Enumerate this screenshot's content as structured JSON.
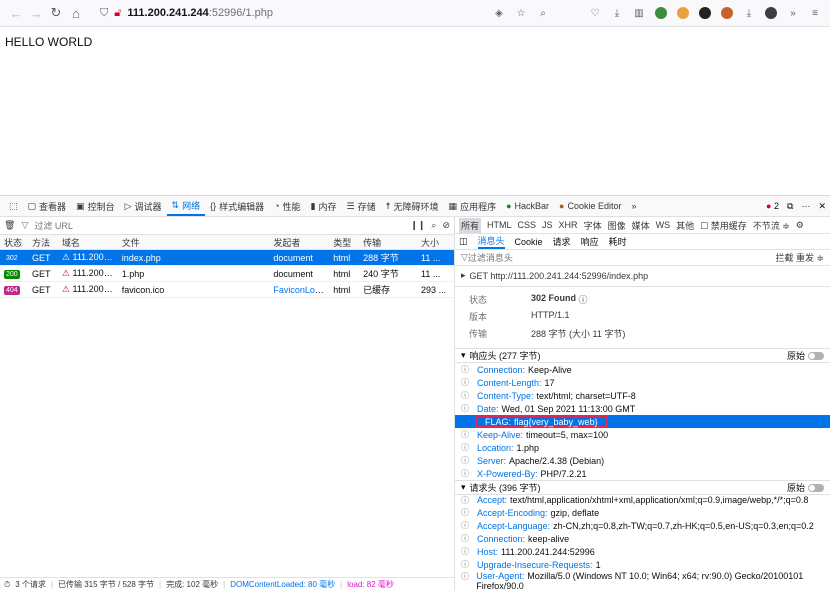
{
  "browser": {
    "url_host": "111.200.241.244",
    "url_path": ":52996/1.php"
  },
  "page": {
    "text": "HELLO WORLD"
  },
  "devtools": {
    "tabs": [
      "查看器",
      "控制台",
      "调试器",
      "网络",
      "样式编辑器",
      "性能",
      "内存",
      "存储",
      "无障碍环境",
      "应用程序",
      "HackBar",
      "Cookie Editor"
    ],
    "error_count": "2",
    "filter_placeholder": "过滤 URL",
    "columns": [
      "状态",
      "方法",
      "域名",
      "文件",
      "发起者",
      "类型",
      "传输",
      "大小"
    ],
    "requests": [
      {
        "status": "302",
        "method": "GET",
        "domain": "111.200.2...",
        "file": "index.php",
        "initiator": "document",
        "type": "html",
        "transfer": "288 字节",
        "size": "11 ..."
      },
      {
        "status": "200",
        "method": "GET",
        "domain": "111.200.2...",
        "file": "1.php",
        "initiator": "document",
        "type": "html",
        "transfer": "240 字节",
        "size": "11 ..."
      },
      {
        "status": "404",
        "method": "GET",
        "domain": "111.200.2...",
        "file": "favicon.ico",
        "initiator": "FaviconLoad...",
        "type": "html",
        "transfer": "已缓存",
        "size": "293 ..."
      }
    ],
    "summary": {
      "requests": "3 个请求",
      "transferred": "已传输 315 字节 / 528 字节",
      "finish": "完成: 102 毫秒",
      "dcl": "DOMContentLoaded: 80 毫秒",
      "load": "load: 82 毫秒"
    },
    "type_filters": [
      "所有",
      "HTML",
      "CSS",
      "JS",
      "XHR",
      "字体",
      "图像",
      "媒体",
      "WS",
      "其他"
    ],
    "disable_cache": "禁用缓存",
    "throttle": "不节流 ≑",
    "detail_tabs": [
      "消息头",
      "Cookie",
      "请求",
      "响应",
      "耗时"
    ],
    "header_filter": "过滤消息头",
    "block_resend": "拦截 重发 ≑",
    "get_line": "GET http://111.200.241.244:52996/index.php",
    "status_info": [
      {
        "k": "状态",
        "v": "302 Found"
      },
      {
        "k": "版本",
        "v": "HTTP/1.1"
      },
      {
        "k": "传输",
        "v": "288 字节 (大小 11 字节)"
      }
    ],
    "resp_section": "响应头 (277 字节)",
    "raw_label": "原始",
    "resp_headers": [
      {
        "n": "Connection:",
        "v": "Keep-Alive"
      },
      {
        "n": "Content-Length:",
        "v": "17"
      },
      {
        "n": "Content-Type:",
        "v": "text/html; charset=UTF-8"
      },
      {
        "n": "Date:",
        "v": "Wed, 01 Sep 2021 11:13:00 GMT"
      },
      {
        "n": "FLAG:",
        "v": "flag{very_baby_web}"
      },
      {
        "n": "Keep-Alive:",
        "v": "timeout=5, max=100"
      },
      {
        "n": "Location:",
        "v": "1.php"
      },
      {
        "n": "Server:",
        "v": "Apache/2.4.38 (Debian)"
      },
      {
        "n": "X-Powered-By:",
        "v": "PHP/7.2.21"
      }
    ],
    "req_section": "请求头 (396 字节)",
    "req_headers": [
      {
        "n": "Accept:",
        "v": "text/html,application/xhtml+xml,application/xml;q=0.9,image/webp,*/*;q=0.8"
      },
      {
        "n": "Accept-Encoding:",
        "v": "gzip, deflate"
      },
      {
        "n": "Accept-Language:",
        "v": "zh-CN,zh;q=0.8,zh-TW;q=0.7,zh-HK;q=0.5,en-US;q=0.3,en;q=0.2"
      },
      {
        "n": "Connection:",
        "v": "keep-alive"
      },
      {
        "n": "Host:",
        "v": "111.200.241.244:52996"
      },
      {
        "n": "Upgrade-Insecure-Requests:",
        "v": "1"
      },
      {
        "n": "User-Agent:",
        "v": "Mozilla/5.0 (Windows NT 10.0; Win64; x64; rv:90.0) Gecko/20100101 Firefox/90.0"
      }
    ]
  }
}
